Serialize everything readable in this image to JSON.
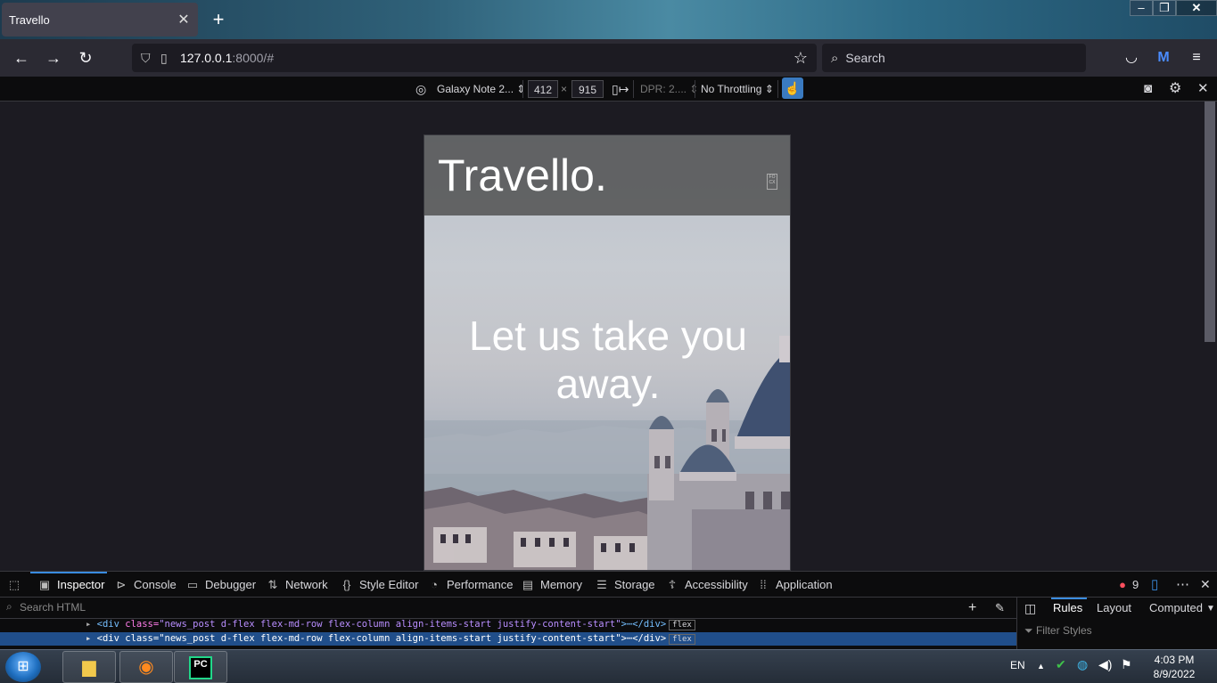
{
  "browser": {
    "tab_title": "Travello",
    "url_host": "127.0.0.1",
    "url_rest": ":8000/#",
    "search_placeholder": "Search"
  },
  "rdm": {
    "device": "Galaxy Note 2...",
    "width": "412",
    "times": "×",
    "height": "915",
    "dpr": "DPR: 2....",
    "throttling": "No Throttling"
  },
  "site": {
    "brand": "Travello.",
    "tagline": "Let us take you away.",
    "toggler_text": "FO CX"
  },
  "devtools": {
    "tabs": [
      {
        "label": "Inspector",
        "icon": "inspector-icon"
      },
      {
        "label": "Console",
        "icon": "console-icon"
      },
      {
        "label": "Debugger",
        "icon": "debugger-icon"
      },
      {
        "label": "Network",
        "icon": "network-icon"
      },
      {
        "label": "Style Editor",
        "icon": "style-editor-icon"
      },
      {
        "label": "Performance",
        "icon": "performance-icon"
      },
      {
        "label": "Memory",
        "icon": "memory-icon"
      },
      {
        "label": "Storage",
        "icon": "storage-icon"
      },
      {
        "label": "Accessibility",
        "icon": "accessibility-icon"
      },
      {
        "label": "Application",
        "icon": "application-icon"
      }
    ],
    "error_count": "9",
    "search_html_placeholder": "Search HTML",
    "markup_lines": [
      {
        "tag": "<div ",
        "attr": "class=",
        "value": "\"news_post d-flex flex-md-row flex-column align-items-start justify-content-start\"",
        "end": ">⋯</div>",
        "badge": "flex"
      },
      {
        "tag": "<div ",
        "attr": "class=",
        "value": "\"news_post d-flex flex-md-row flex-column align-items-start justify-content-start\"",
        "end": ">⋯</div>",
        "badge": "flex"
      }
    ],
    "side_tabs": [
      "Rules",
      "Layout",
      "Computed"
    ],
    "filter_placeholder": "Filter Styles"
  },
  "taskbar": {
    "lang": "EN",
    "time": "4:03 PM",
    "date": "8/9/2022",
    "pycharm_label": "PC"
  },
  "colors": {
    "accent": "#3a8ce0",
    "selected_row": "#204e8a"
  }
}
